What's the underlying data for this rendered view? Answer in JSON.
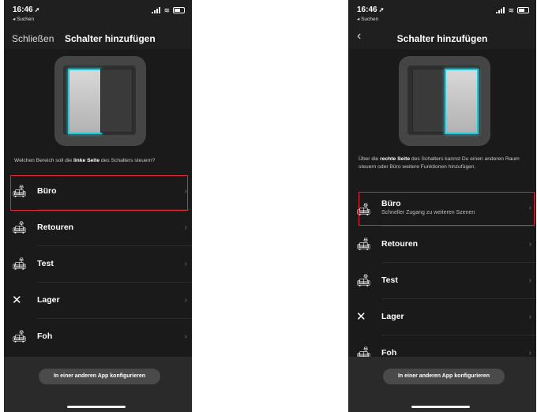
{
  "status": {
    "time": "16:46",
    "back_app": "◂ Suchen"
  },
  "left": {
    "header": {
      "close": "Schließen",
      "title": "Schalter hinzufügen"
    },
    "prompt": {
      "pre": "Welchen Bereich soll die ",
      "bold": "linke Seite",
      "post": " des Schalters steuern?"
    },
    "rooms": [
      {
        "label": "Büro",
        "icon": "sofa-icon"
      },
      {
        "label": "Retouren",
        "icon": "sofa-icon"
      },
      {
        "label": "Test",
        "icon": "sofa-icon"
      },
      {
        "label": "Lager",
        "icon": "tools-icon"
      },
      {
        "label": "Foh",
        "icon": "sofa-icon"
      }
    ],
    "highlighted_room": "Büro",
    "selected_rocker": "left",
    "config_button": "In einer anderen App konfigurieren"
  },
  "right": {
    "header": {
      "title": "Schalter hinzufügen"
    },
    "prompt": {
      "pre": "Über die ",
      "bold": "rechte Seite",
      "post": " des Schalters kannst Du einen anderen Raum steuern oder Büro weitere Funktionen hinzufügen."
    },
    "rooms": [
      {
        "label": "Büro",
        "sub": "Schneller Zugang zu weiteren Szenen",
        "icon": "sofa-icon"
      },
      {
        "label": "Retouren",
        "icon": "sofa-icon"
      },
      {
        "label": "Test",
        "icon": "sofa-icon"
      },
      {
        "label": "Lager",
        "icon": "tools-icon"
      },
      {
        "label": "Foh",
        "icon": "sofa-icon"
      }
    ],
    "highlighted_room": "Büro",
    "selected_rocker": "right",
    "config_button": "In einer anderen App konfigurieren"
  },
  "colors": {
    "accent": "#25c4d6",
    "highlight": "#e0243b",
    "background": "#1a1a1a"
  }
}
